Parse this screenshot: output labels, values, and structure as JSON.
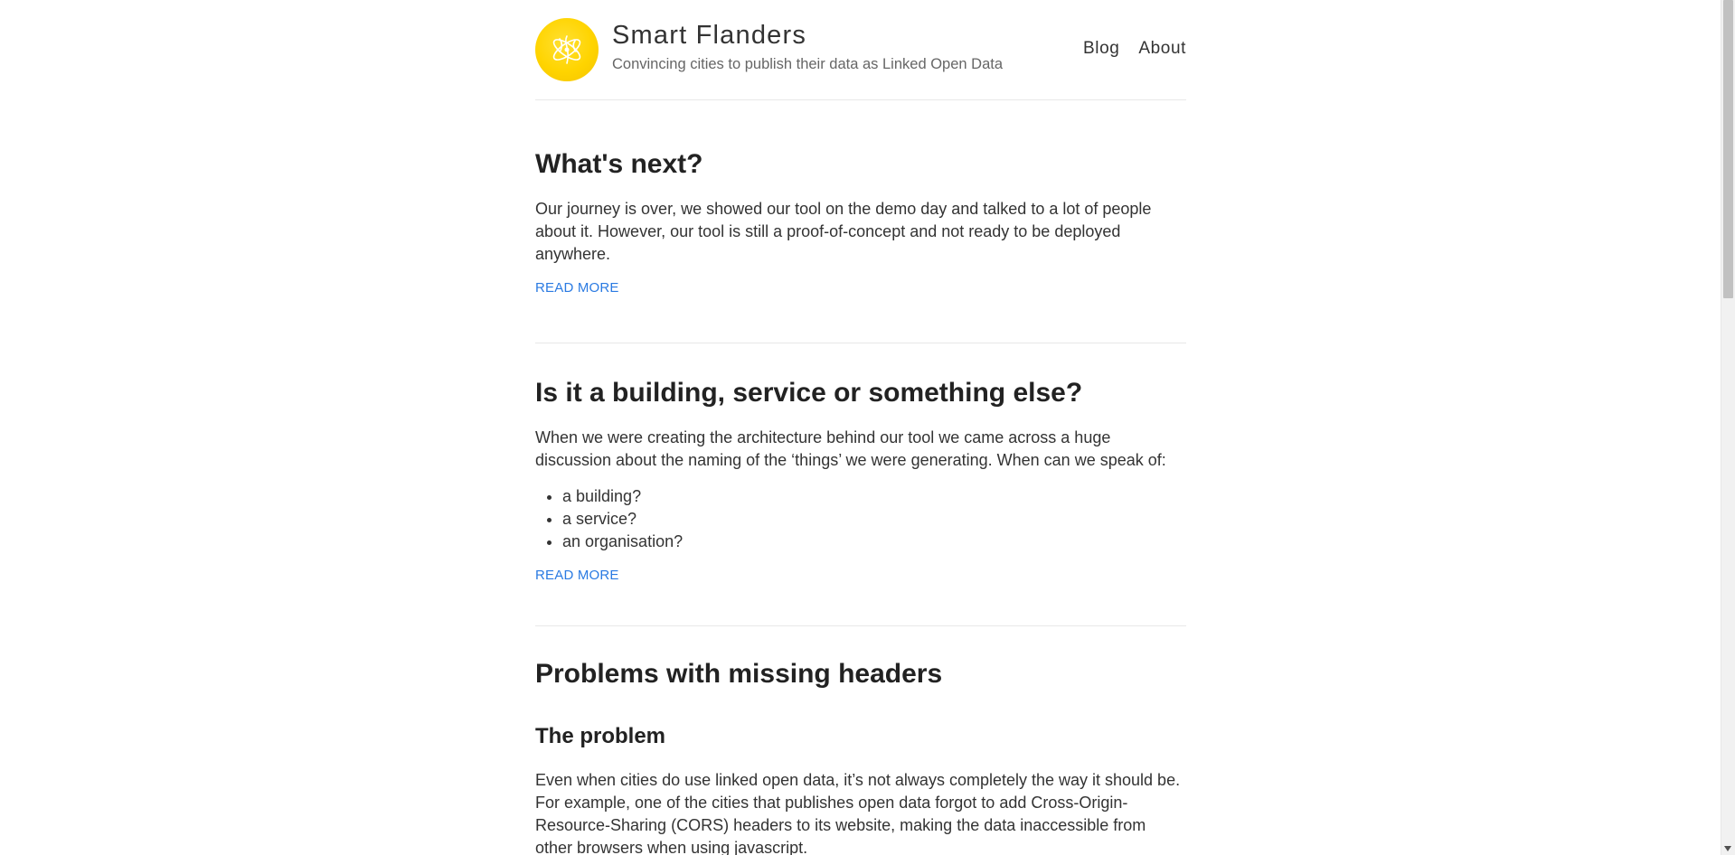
{
  "header": {
    "title": "Smart Flanders",
    "tagline": "Convincing cities to publish their data as Linked Open Data",
    "logo_color": "#ffd400"
  },
  "nav": {
    "blog": "Blog",
    "about": "About"
  },
  "posts": [
    {
      "title": "What's next?",
      "excerpt": "Our journey is over, we showed our tool on the demo day and talked to a lot of people about it. However, our tool is still a proof-of-concept and not ready to be deployed anywhere.",
      "read_more": "READ MORE"
    },
    {
      "title": "Is it a building, service or something else?",
      "excerpt": "When we were creating the architecture behind our tool we came across a huge discussion about the naming of the ‘things’ we were generating. When can we speak of:",
      "items": [
        "a building?",
        "a service?",
        "an organisation?"
      ],
      "read_more": "READ MORE"
    },
    {
      "title": "Problems with missing headers",
      "subheading": "The problem",
      "excerpt": "Even when cities do use linked open data, it’s not always completely the way it should be. For example, one of the cities that publishes open data forgot to add Cross-Origin-Resource-Sharing (CORS) headers to its website, making the data inaccessible from other browsers when using javascript."
    }
  ],
  "colors": {
    "link": "#2a7ae2",
    "text": "#333333",
    "divider": "#e8e8e8"
  }
}
